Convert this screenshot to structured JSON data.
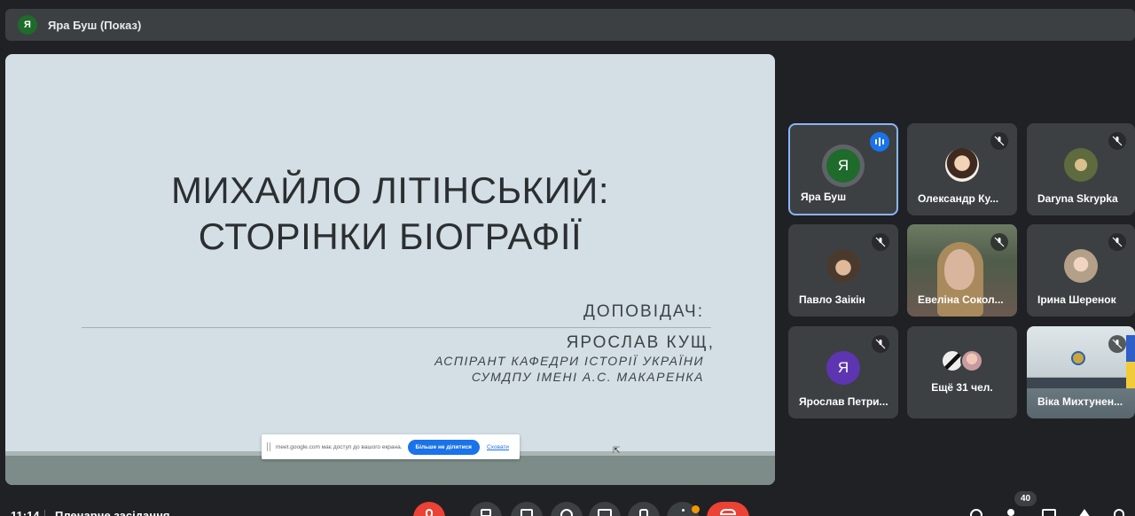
{
  "presenter_bar": {
    "avatar_letter": "Я",
    "label": "Яра Буш (Показ)"
  },
  "slide": {
    "title_line1": "МИХАЙЛО ЛІТІНСЬКИЙ:",
    "title_line2": "СТОРІНКИ БІОГРАФІЇ",
    "speaker_label": "ДОПОВІДАЧ:",
    "speaker_name": "ЯРОСЛАВ КУЩ,",
    "speaker_line1": "АСПІРАНТ КАФЕДРИ ІСТОРІЇ УКРАЇНИ",
    "speaker_line2": "СУМДПУ ІМЕНІ А.С. МАКАРЕНКА"
  },
  "share_notice": {
    "message": "meet.google.com має доступ до вашого екрана.",
    "stop_label": "Більше не ділитися",
    "hide_label": "Сховати"
  },
  "participants": [
    {
      "name": "Яра Буш",
      "letter": "Я",
      "speaking": true
    },
    {
      "name": "Олександр Ку...",
      "muted": true
    },
    {
      "name": "Daryna Skrypka",
      "muted": true
    },
    {
      "name": "Павло Заікін",
      "muted": true
    },
    {
      "name": "Евеліна Сокол...",
      "muted": true
    },
    {
      "name": "Ірина Шеренок",
      "muted": true
    },
    {
      "name": "Ярослав Петри...",
      "letter": "Я",
      "muted": true
    },
    {
      "name": "Ещё 31 чел."
    },
    {
      "name": "Віка Михтунен...",
      "muted": true
    }
  ],
  "footer": {
    "time": "11:14",
    "meeting_name": "Пленарне засідання",
    "participant_count": "40"
  },
  "colors": {
    "background": "#202124",
    "tile": "#3c4043",
    "active_border": "#8ab4f8",
    "end_call": "#ea4335",
    "accent": "#1a73e8"
  }
}
